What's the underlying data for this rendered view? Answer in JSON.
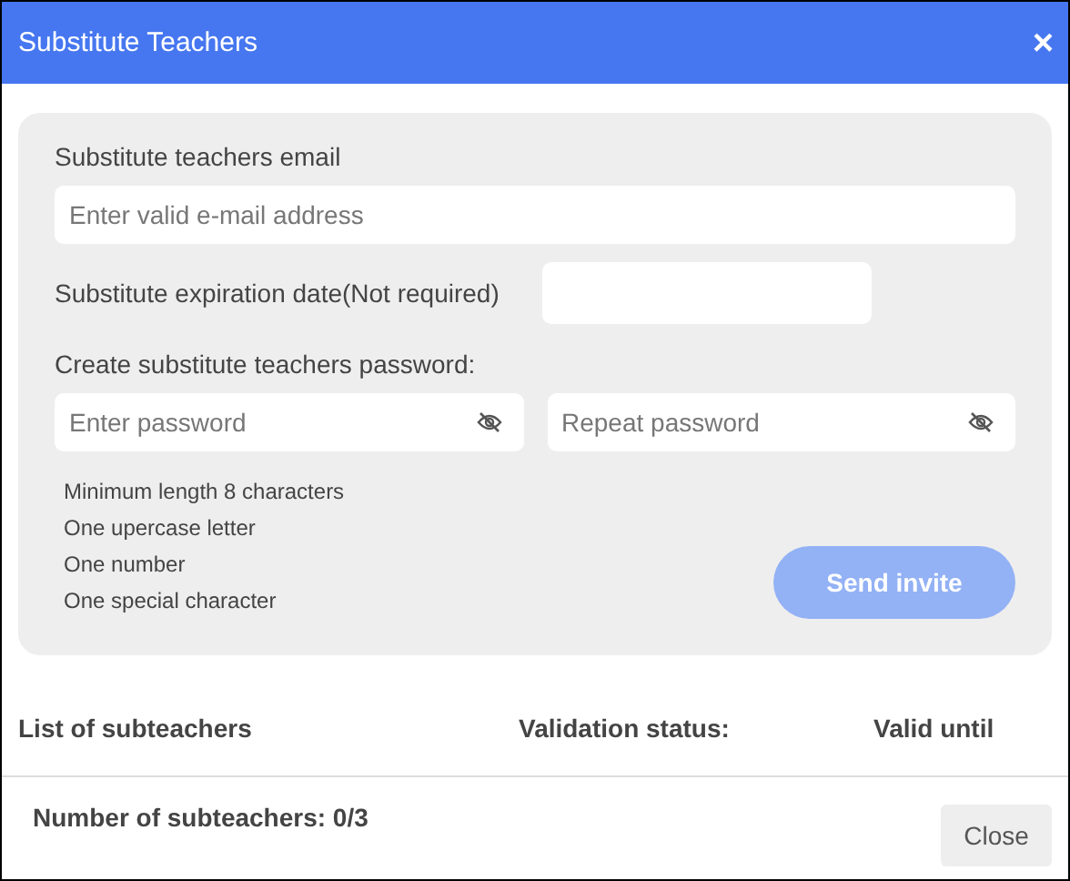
{
  "window": {
    "title": "Substitute Teachers",
    "close": "×"
  },
  "form": {
    "email_label": "Substitute teachers email",
    "email_placeholder": "Enter valid e-mail address",
    "expiration_label": "Substitute expiration date(Not required)",
    "password_label": "Create substitute teachers password:",
    "password_fields": [
      {
        "placeholder": "Enter password"
      },
      {
        "placeholder": "Repeat password"
      }
    ],
    "requirements": [
      "Minimum length 8 characters",
      "One upercase letter",
      "One number",
      "One special character"
    ],
    "send_button": {
      "label": "Send invite",
      "disabled": true
    }
  },
  "table": {
    "columns": [
      "List of subteachers",
      "Validation status:",
      "Valid until"
    ]
  },
  "footer": {
    "count": "Number of subteachers: 0/3",
    "close_button": "Close"
  }
}
